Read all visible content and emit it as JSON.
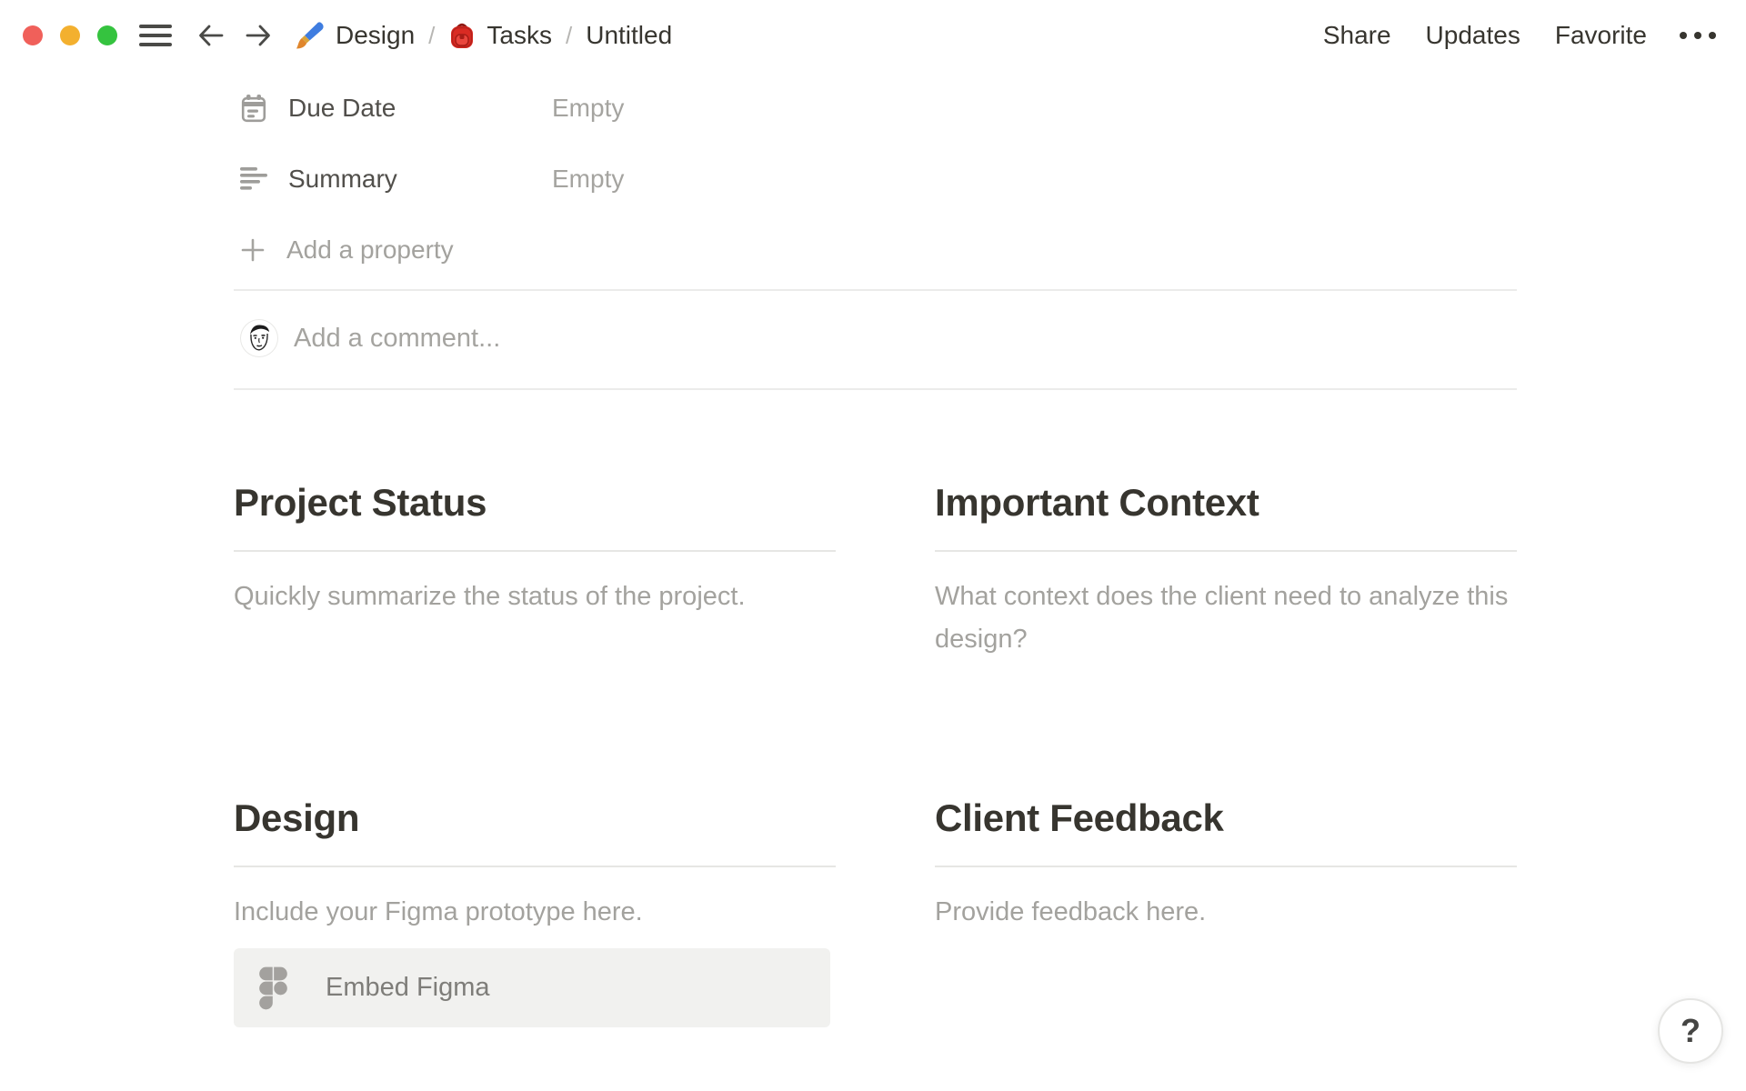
{
  "topbar": {
    "separator": "/",
    "breadcrumb": {
      "design_label": "Design",
      "tasks_label": "Tasks",
      "page_label": "Untitled"
    },
    "actions": {
      "share": "Share",
      "updates": "Updates",
      "favorite": "Favorite"
    }
  },
  "properties": {
    "rows": [
      {
        "icon": "calendar-icon",
        "name": "Due Date",
        "value": "Empty"
      },
      {
        "icon": "align-left-icon",
        "name": "Summary",
        "value": "Empty"
      }
    ],
    "add_property_label": "Add a property"
  },
  "comment": {
    "placeholder": "Add a comment..."
  },
  "sections": [
    {
      "title": "Project Status",
      "body": "Quickly summarize the status of the project."
    },
    {
      "title": "Important Context",
      "body": "What context does the client need to analyze this design?"
    },
    {
      "title": "Design",
      "body": "Include your Figma prototype here.",
      "embed_button": "Embed Figma"
    },
    {
      "title": "Client Feedback",
      "body": "Provide feedback here."
    }
  ],
  "help_button": "?",
  "colors": {
    "traffic_red": "#f0605a",
    "traffic_yellow": "#f3b02f",
    "traffic_green": "#35c33f",
    "text_dark": "#37352f",
    "text_muted": "#a5a4a0",
    "divider": "#ebebea",
    "embed_background": "#f1f1ef"
  }
}
